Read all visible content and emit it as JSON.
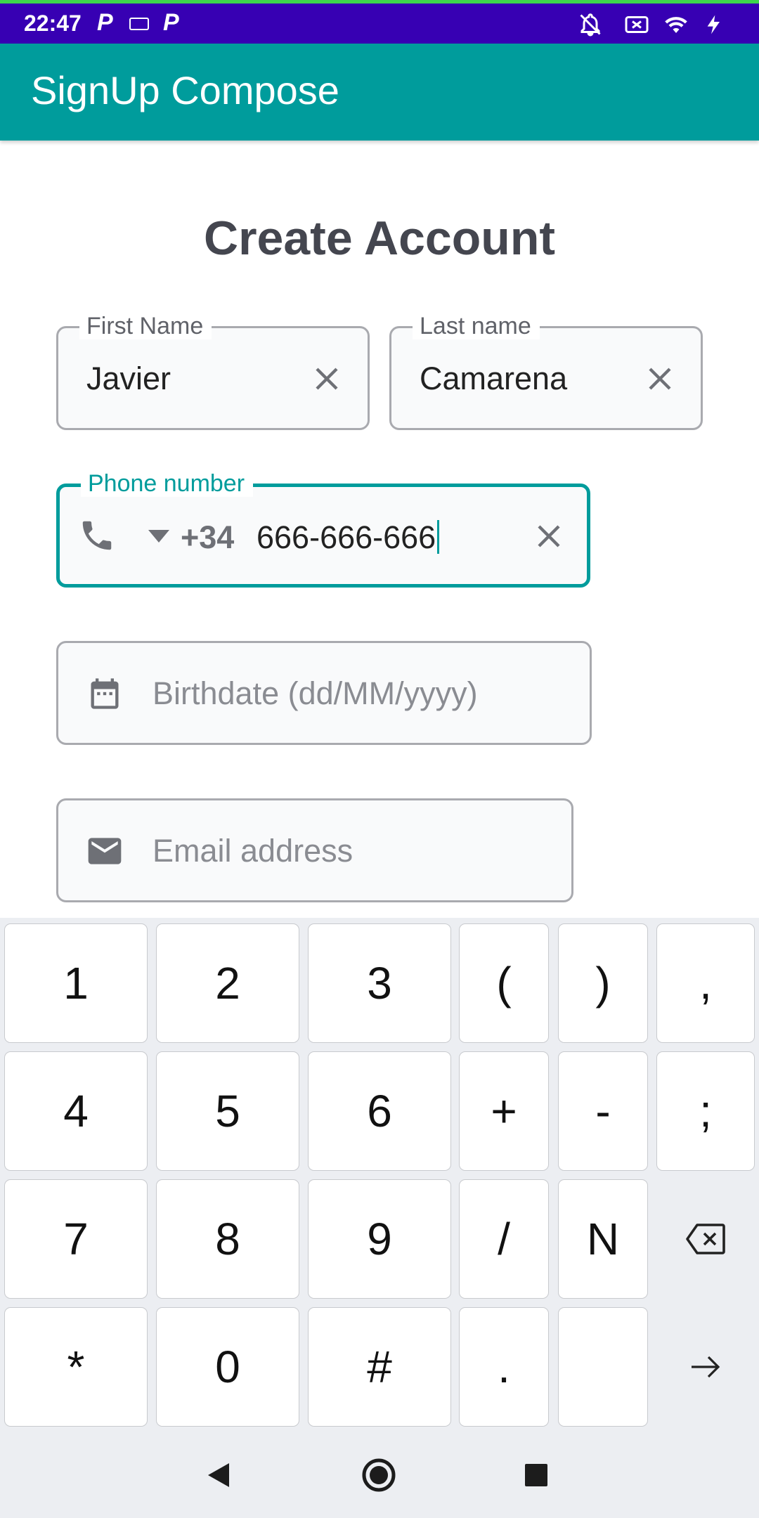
{
  "status_bar": {
    "time": "22:47",
    "left_icons": [
      "parking-icon",
      "keyboard-icon",
      "parking-icon"
    ],
    "right_icons": [
      "notifications-off-icon",
      "no-sim-icon",
      "wifi-icon",
      "charging-icon"
    ]
  },
  "app_bar": {
    "title": "SignUp Compose"
  },
  "form": {
    "title": "Create Account",
    "first_name": {
      "label": "First Name",
      "value": "Javier"
    },
    "last_name": {
      "label": "Last name",
      "value": "Camarena"
    },
    "phone": {
      "label": "Phone number",
      "country_code": "+34",
      "value": "666-666-666"
    },
    "birthdate": {
      "placeholder": "Birthdate (dd/MM/yyyy)"
    },
    "email": {
      "placeholder": "Email address"
    }
  },
  "keyboard": {
    "rows": [
      [
        "1",
        "2",
        "3",
        "(",
        ")",
        ","
      ],
      [
        "4",
        "5",
        "6",
        "+",
        "-",
        ";"
      ],
      [
        "7",
        "8",
        "9",
        "/",
        "N"
      ],
      [
        "*",
        "0",
        "#",
        ".",
        ""
      ]
    ],
    "special_keys": [
      "backspace-icon",
      "enter-arrow-icon"
    ]
  },
  "nav_bar": {
    "buttons": [
      "back-icon",
      "home-icon",
      "recents-icon"
    ]
  },
  "colors": {
    "accent": "#009c9c",
    "status_bar": "#3700b3",
    "title_text": "#44464f"
  }
}
